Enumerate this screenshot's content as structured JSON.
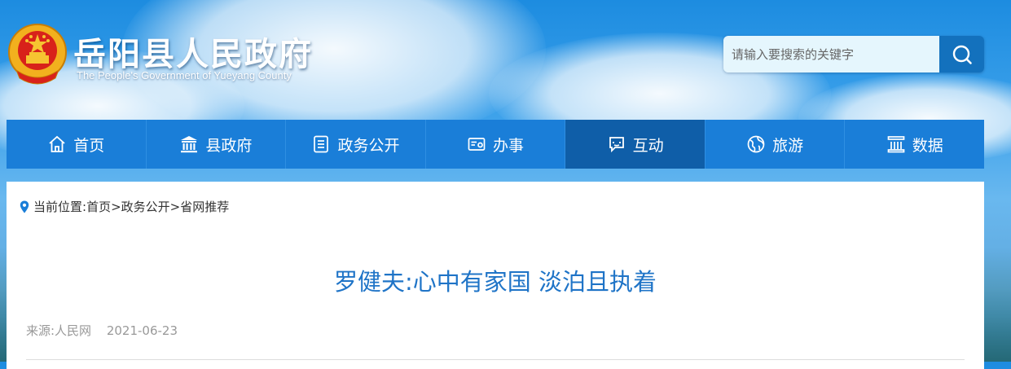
{
  "header": {
    "site_title": "岳阳县人民政府",
    "site_subtitle": "The People's Government of Yueyang County"
  },
  "search": {
    "placeholder": "请输入要搜索的关键字",
    "button_icon": "search-icon"
  },
  "nav": {
    "items": [
      {
        "label": "首页",
        "icon": "home-icon"
      },
      {
        "label": "县政府",
        "icon": "government-building-icon"
      },
      {
        "label": "政务公开",
        "icon": "document-list-icon"
      },
      {
        "label": "办事",
        "icon": "service-card-icon"
      },
      {
        "label": "互动",
        "icon": "chat-icon",
        "active": true
      },
      {
        "label": "旅游",
        "icon": "globe-icon"
      },
      {
        "label": "数据",
        "icon": "data-chart-icon"
      }
    ]
  },
  "breadcrumb": {
    "prefix": "当前位置:",
    "items": [
      "首页",
      "政务公开",
      "省网推荐"
    ],
    "separator": ">"
  },
  "article": {
    "title": "罗健夫:心中有家国 淡泊且执着",
    "source": "来源:人民网",
    "date": "2021-06-23"
  },
  "colors": {
    "nav_bg": "#1a7ed8",
    "nav_active": "#0f5ea8",
    "title_blue": "#1f74c7",
    "search_button": "#1371bd"
  }
}
